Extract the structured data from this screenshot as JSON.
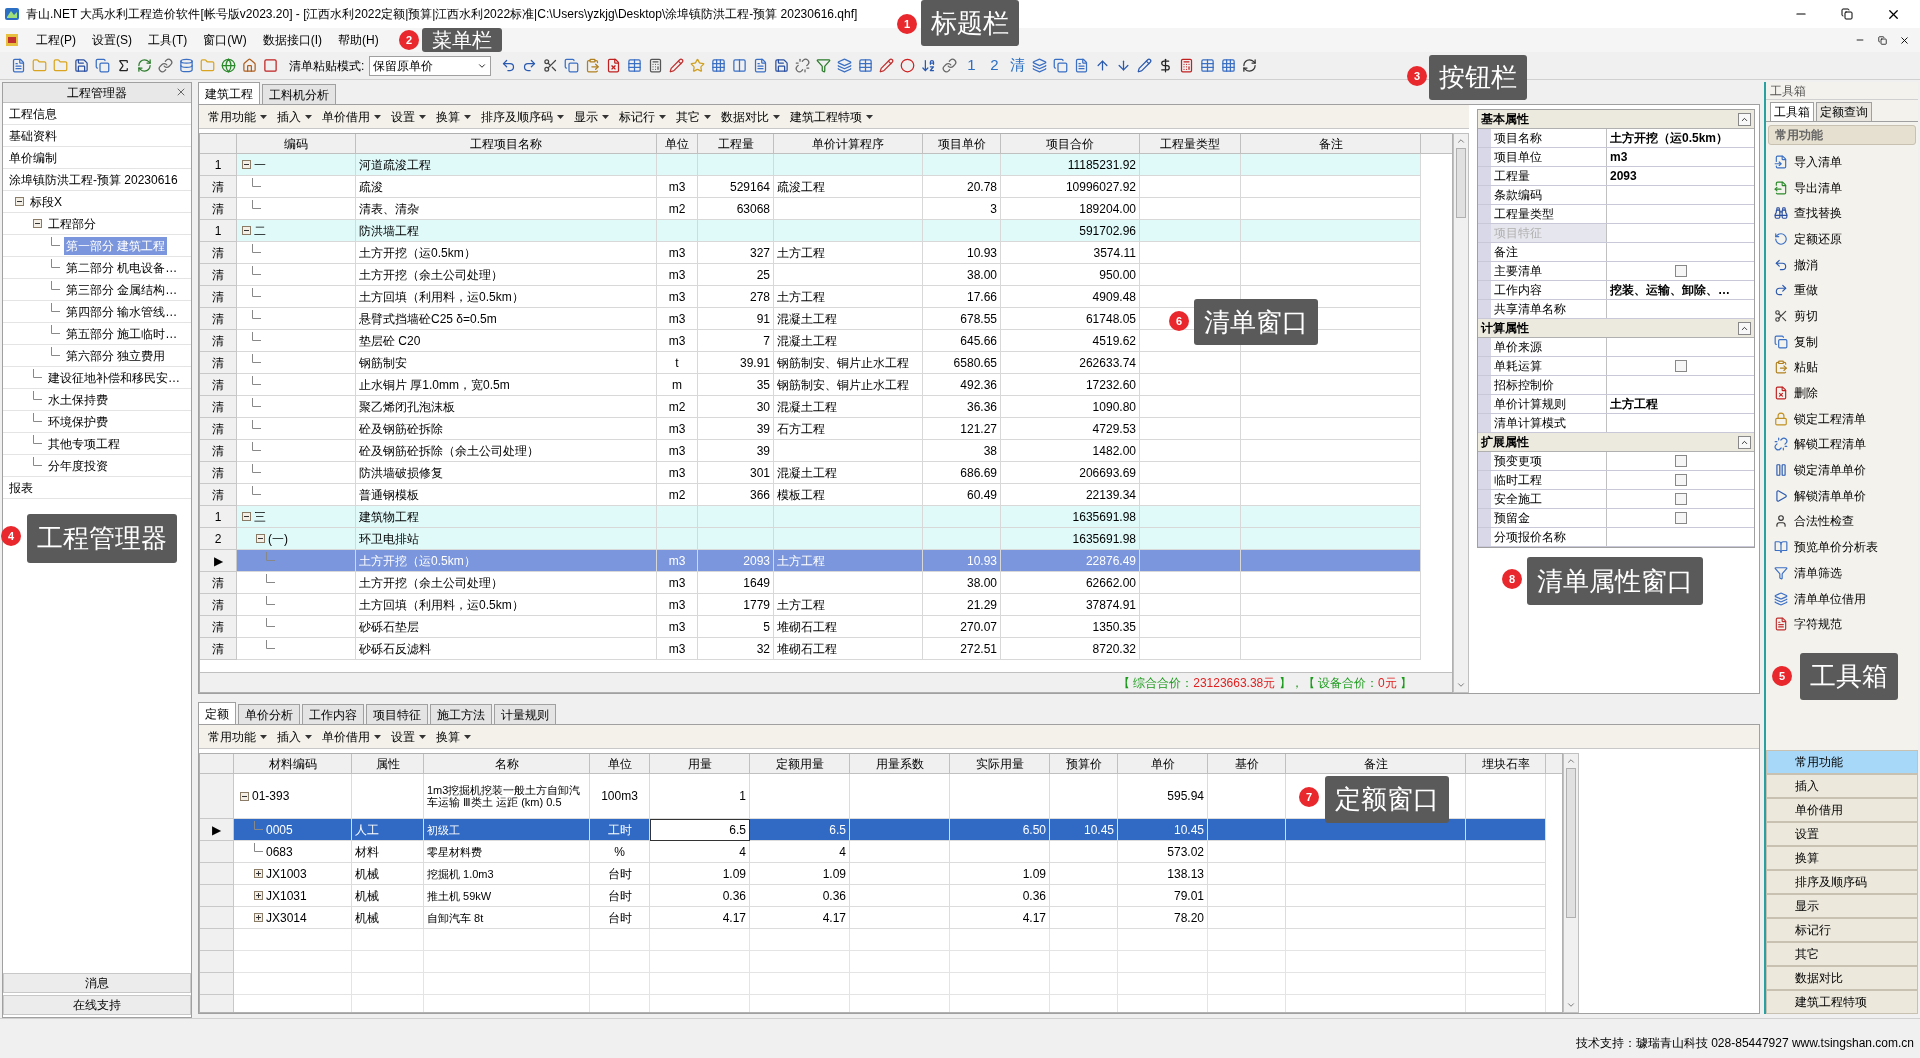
{
  "window": {
    "title": "青山.NET 大禹水利工程造价软件[帐号版v2023.20] - [江西水利2022定额|预算|江西水利2022标准|C:\\Users\\yzkjg\\Desktop\\涂埠镇防洪工程-预算 20230616.qhf]"
  },
  "menu": [
    "工程(P)",
    "设置(S)",
    "工具(T)",
    "窗口(W)",
    "数据接口(I)",
    "帮助(H)"
  ],
  "toolbar": {
    "paste_mode_label": "清单粘贴模式:",
    "paste_mode_value": "保留原单价",
    "text_buttons": [
      "1",
      "2",
      "清"
    ]
  },
  "project_manager": {
    "title": "工程管理器",
    "items": [
      {
        "label": "工程信息",
        "selected": false
      },
      {
        "label": "基础资料",
        "selected": false
      },
      {
        "label": "单价编制",
        "selected": false
      },
      {
        "label": "涂埠镇防洪工程-预算 20230616",
        "selected": false
      }
    ],
    "tree": [
      {
        "label": "标段X",
        "selected": false,
        "expanded": true,
        "children": [
          {
            "label": "工程部分",
            "selected": false,
            "expanded": true,
            "children": [
              {
                "label": "第一部分 建筑工程",
                "selected": true
              },
              {
                "label": "第二部分 机电设备…",
                "selected": false
              },
              {
                "label": "第三部分 金属结构…",
                "selected": false
              },
              {
                "label": "第四部分 输水管线…",
                "selected": false
              },
              {
                "label": "第五部分 施工临时…",
                "selected": false
              },
              {
                "label": "第六部分 独立费用",
                "selected": false
              }
            ]
          },
          {
            "label": "建设征地补偿和移民安…",
            "selected": false
          },
          {
            "label": "水土保持费",
            "selected": false
          },
          {
            "label": "环境保护费",
            "selected": false
          },
          {
            "label": "其他专项工程",
            "selected": false
          },
          {
            "label": "分年度投资",
            "selected": false
          }
        ]
      }
    ],
    "reports": "报表",
    "footer_buttons": [
      "消息",
      "在线支持"
    ]
  },
  "upper_tabs": [
    {
      "label": "建筑工程",
      "selected": true
    },
    {
      "label": "工料机分析",
      "selected": false
    }
  ],
  "bill_toolbar": [
    "常用功能",
    "插入",
    "单价借用",
    "设置",
    "换算",
    "排序及顺序码",
    "显示",
    "标记行",
    "其它",
    "数据对比",
    "建筑工程特项"
  ],
  "bill_grid": {
    "columns": [
      "编码",
      "工程项目名称",
      "单位",
      "工程量",
      "单价计算程序",
      "项目单价",
      "项目合价",
      "工程量类型",
      "备注"
    ],
    "rows": [
      {
        "kind": "group",
        "header": "1",
        "code": "一",
        "name": "河道疏浚工程",
        "total": "11185231.92",
        "expanded": true,
        "selected": false,
        "children": [
          {
            "kind": "item",
            "header": "清",
            "name": "疏浚",
            "unit": "m3",
            "qty": "529164",
            "program": "疏浚工程",
            "price": "20.78",
            "total": "10996027.92",
            "selected": false
          },
          {
            "kind": "item",
            "header": "清",
            "name": "清表、清杂",
            "unit": "m2",
            "qty": "63068",
            "price": "3",
            "total": "189204.00",
            "selected": false
          }
        ]
      },
      {
        "kind": "group",
        "header": "1",
        "code": "二",
        "name": "防洪墙工程",
        "total": "591702.96",
        "expanded": true,
        "selected": false,
        "children": [
          {
            "kind": "item",
            "header": "清",
            "name": "土方开挖（运0.5km）",
            "unit": "m3",
            "qty": "327",
            "program": "土方工程",
            "price": "10.93",
            "total": "3574.11",
            "selected": false
          },
          {
            "kind": "item",
            "header": "清",
            "name": "土方开挖（余土公司处理）",
            "unit": "m3",
            "qty": "25",
            "price": "38.00",
            "total": "950.00",
            "selected": false
          },
          {
            "kind": "item",
            "header": "清",
            "name": "土方回填（利用料，运0.5km）",
            "unit": "m3",
            "qty": "278",
            "program": "土方工程",
            "price": "17.66",
            "total": "4909.48",
            "selected": false
          },
          {
            "kind": "item",
            "header": "清",
            "name": "悬臂式挡墙砼C25 δ=0.5m",
            "unit": "m3",
            "qty": "91",
            "program": "混凝土工程",
            "price": "678.55",
            "total": "61748.05",
            "selected": false
          },
          {
            "kind": "item",
            "header": "清",
            "name": "垫层砼 C20",
            "unit": "m3",
            "qty": "7",
            "program": "混凝土工程",
            "price": "645.66",
            "total": "4519.62",
            "selected": false
          },
          {
            "kind": "item",
            "header": "清",
            "name": "钢筋制安",
            "unit": "t",
            "qty": "39.91",
            "program": "钢筋制安、铜片止水工程",
            "price": "6580.65",
            "total": "262633.74",
            "selected": false
          },
          {
            "kind": "item",
            "header": "清",
            "name": "止水铜片 厚1.0mm，宽0.5m",
            "unit": "m",
            "qty": "35",
            "program": "钢筋制安、铜片止水工程",
            "price": "492.36",
            "total": "17232.60",
            "selected": false
          },
          {
            "kind": "item",
            "header": "清",
            "name": "聚乙烯闭孔泡沫板",
            "unit": "m2",
            "qty": "30",
            "program": "混凝土工程",
            "price": "36.36",
            "total": "1090.80",
            "selected": false
          },
          {
            "kind": "item",
            "header": "清",
            "name": "砼及钢筋砼拆除",
            "unit": "m3",
            "qty": "39",
            "program": "石方工程",
            "price": "121.27",
            "total": "4729.53",
            "selected": false
          },
          {
            "kind": "item",
            "header": "清",
            "name": "砼及钢筋砼拆除（余土公司处理）",
            "unit": "m3",
            "qty": "39",
            "price": "38",
            "total": "1482.00",
            "selected": false
          },
          {
            "kind": "item",
            "header": "清",
            "name": "防洪墙破损修复",
            "unit": "m3",
            "qty": "301",
            "program": "混凝土工程",
            "price": "686.69",
            "total": "206693.69",
            "selected": false
          },
          {
            "kind": "item",
            "header": "清",
            "name": "普通钢模板",
            "unit": "m2",
            "qty": "366",
            "program": "模板工程",
            "price": "60.49",
            "total": "22139.34",
            "selected": false
          }
        ]
      },
      {
        "kind": "group",
        "header": "1",
        "code": "三",
        "name": "建筑物工程",
        "total": "1635691.98",
        "expanded": true,
        "selected": false,
        "children": [
          {
            "kind": "group",
            "header": "2",
            "code": "(一)",
            "name": "环卫电排站",
            "total": "1635691.98",
            "expanded": true,
            "selected": false,
            "children": [
              {
                "kind": "item",
                "header": "▶",
                "name": "土方开挖（运0.5km）",
                "unit": "m3",
                "qty": "2093",
                "program": "土方工程",
                "price": "10.93",
                "total": "22876.49",
                "selected": true
              },
              {
                "kind": "item",
                "header": "清",
                "name": "土方开挖（余土公司处理）",
                "unit": "m3",
                "qty": "1649",
                "price": "38.00",
                "total": "62662.00",
                "selected": false
              },
              {
                "kind": "item",
                "header": "清",
                "name": "土方回填（利用料，运0.5km）",
                "unit": "m3",
                "qty": "1779",
                "program": "土方工程",
                "price": "21.29",
                "total": "37874.91",
                "selected": false
              },
              {
                "kind": "item",
                "header": "清",
                "name": "砂砾石垫层",
                "unit": "m3",
                "qty": "5",
                "program": "堆砌石工程",
                "price": "270.07",
                "total": "1350.35",
                "selected": false
              },
              {
                "kind": "item",
                "header": "清",
                "name": "砂砾石反滤料",
                "unit": "m3",
                "qty": "32",
                "program": "堆砌石工程",
                "price": "272.51",
                "total": "8720.32",
                "selected": false
              }
            ]
          }
        ]
      }
    ]
  },
  "summary": [
    {
      "label": "【 综合合价：",
      "value": "23123663.38元",
      "suffix": " 】，"
    },
    {
      "label": "【 设备合价：",
      "value": "0元",
      "suffix": " 】"
    }
  ],
  "properties": [
    {
      "title": "基本属性",
      "rows": [
        {
          "kind": "text",
          "label": "项目名称",
          "value": "土方开挖（运0.5km）",
          "disabled": false
        },
        {
          "kind": "text",
          "label": "项目单位",
          "value": "m3",
          "disabled": false
        },
        {
          "kind": "text",
          "label": "工程量",
          "value": "2093",
          "disabled": false
        },
        {
          "kind": "text",
          "label": "条款编码",
          "disabled": false
        },
        {
          "kind": "text",
          "label": "工程量类型",
          "disabled": false
        },
        {
          "kind": "text",
          "label": "项目特征",
          "disabled": true
        },
        {
          "kind": "text",
          "label": "备注",
          "disabled": false
        },
        {
          "kind": "checkbox",
          "label": "主要清单",
          "checked": false,
          "disabled": false
        },
        {
          "kind": "text",
          "label": "工作内容",
          "value": "挖装、运输、卸除、…",
          "disabled": false
        },
        {
          "kind": "text",
          "label": "共享清单名称",
          "disabled": false
        }
      ]
    },
    {
      "title": "计算属性",
      "rows": [
        {
          "kind": "text",
          "label": "单价来源",
          "disabled": false
        },
        {
          "kind": "checkbox",
          "label": "单耗运算",
          "checked": false,
          "disabled": false
        },
        {
          "kind": "text",
          "label": "招标控制价",
          "disabled": false
        },
        {
          "kind": "text",
          "label": "单价计算规则",
          "value": "土方工程",
          "disabled": false
        },
        {
          "kind": "text",
          "label": "清单计算模式",
          "disabled": false
        }
      ]
    },
    {
      "title": "扩展属性",
      "rows": [
        {
          "kind": "checkbox",
          "label": "预变更项",
          "checked": false,
          "disabled": false
        },
        {
          "kind": "checkbox",
          "label": "临时工程",
          "checked": false,
          "disabled": false
        },
        {
          "kind": "checkbox",
          "label": "安全施工",
          "checked": false,
          "disabled": false
        },
        {
          "kind": "checkbox",
          "label": "预留金",
          "checked": false,
          "disabled": false
        },
        {
          "kind": "text",
          "label": "分项报价名称",
          "disabled": false
        }
      ]
    }
  ],
  "lower_tabs": [
    {
      "label": "定额",
      "selected": true
    },
    {
      "label": "单价分析",
      "selected": false
    },
    {
      "label": "工作内容",
      "selected": false
    },
    {
      "label": "项目特征",
      "selected": false
    },
    {
      "label": "施工方法",
      "selected": false
    },
    {
      "label": "计量规则",
      "selected": false
    }
  ],
  "quota_toolbar": [
    "常用功能",
    "插入",
    "单价借用",
    "设置",
    "换算"
  ],
  "quota_grid": {
    "columns": [
      "材料编码",
      "属性",
      "名称",
      "单位",
      "用量",
      "定额用量",
      "用量系数",
      "实际用量",
      "预算价",
      "单价",
      "基价",
      "备注",
      "埋块石率"
    ],
    "rows": [
      {
        "kind": "composite",
        "code": "01-393",
        "name": "1m3挖掘机挖装一般土方自卸汽车运输 Ⅲ类土 运距 (km) 0.5",
        "unit": "100m3",
        "qty": "1",
        "price": "595.94",
        "expanded": true,
        "selected": false,
        "children": [
          {
            "kind": "resource",
            "header": "▶",
            "code": "0005",
            "attr": "人工",
            "name": "初级工",
            "unit": "工时",
            "qty": "6.5",
            "quota_qty": "6.5",
            "actual_qty": "6.50",
            "budget_price": "10.45",
            "price": "10.45",
            "selected": true
          },
          {
            "kind": "resource",
            "code": "0683",
            "attr": "材料",
            "name": "零星材料费",
            "unit": "%",
            "qty": "4",
            "quota_qty": "4",
            "price": "573.02",
            "selected": false
          },
          {
            "kind": "composite",
            "code": "JX1003",
            "attr": "机械",
            "name": "挖掘机 1.0m3",
            "unit": "台时",
            "qty": "1.09",
            "quota_qty": "1.09",
            "actual_qty": "1.09",
            "price": "138.13",
            "expanded": false,
            "selected": false
          },
          {
            "kind": "composite",
            "code": "JX1031",
            "attr": "机械",
            "name": "推土机 59kW",
            "unit": "台时",
            "qty": "0.36",
            "quota_qty": "0.36",
            "actual_qty": "0.36",
            "price": "79.01",
            "expanded": false,
            "selected": false
          },
          {
            "kind": "composite",
            "code": "JX3014",
            "attr": "机械",
            "name": "自卸汽车 8t",
            "unit": "台时",
            "qty": "4.17",
            "quota_qty": "4.17",
            "actual_qty": "4.17",
            "price": "78.20",
            "expanded": false,
            "selected": false
          }
        ]
      }
    ]
  },
  "toolbox": {
    "title": "工具箱",
    "tabs": [
      {
        "label": "工具箱",
        "selected": true
      },
      {
        "label": "定额查询",
        "selected": false
      }
    ],
    "section": "常用功能",
    "items": [
      "导入清单",
      "导出清单",
      "查找替换",
      "定额还原",
      "撤消",
      "重做",
      "剪切",
      "复制",
      "粘贴",
      "删除",
      "锁定工程清单",
      "解锁工程清单",
      "锁定清单单价",
      "解锁清单单价",
      "合法性检查",
      "预览单价分析表",
      "清单筛选",
      "清单单位借用",
      "字符规范"
    ],
    "groups": [
      {
        "label": "常用功能",
        "selected": true
      },
      {
        "label": "插入",
        "selected": false
      },
      {
        "label": "单价借用",
        "selected": false
      },
      {
        "label": "设置",
        "selected": false
      },
      {
        "label": "换算",
        "selected": false
      },
      {
        "label": "排序及顺序码",
        "selected": false
      },
      {
        "label": "显示",
        "selected": false
      },
      {
        "label": "标记行",
        "selected": false
      },
      {
        "label": "其它",
        "selected": false
      },
      {
        "label": "数据对比",
        "selected": false
      },
      {
        "label": "建筑工程特项",
        "selected": false
      }
    ]
  },
  "status_bar": "技术支持：璩瑞青山科技 028-85447927 www.tsingshan.com.cn",
  "callouts": [
    {
      "number": "1",
      "label": "标题栏"
    },
    {
      "number": "2",
      "label": "菜单栏"
    },
    {
      "number": "3",
      "label": "按钮栏"
    },
    {
      "number": "4",
      "label": "工程管理器"
    },
    {
      "number": "5",
      "label": "工具箱"
    },
    {
      "number": "6",
      "label": "清单窗口"
    },
    {
      "number": "7",
      "label": "定额窗口"
    },
    {
      "number": "8",
      "label": "清单属性窗口"
    }
  ]
}
